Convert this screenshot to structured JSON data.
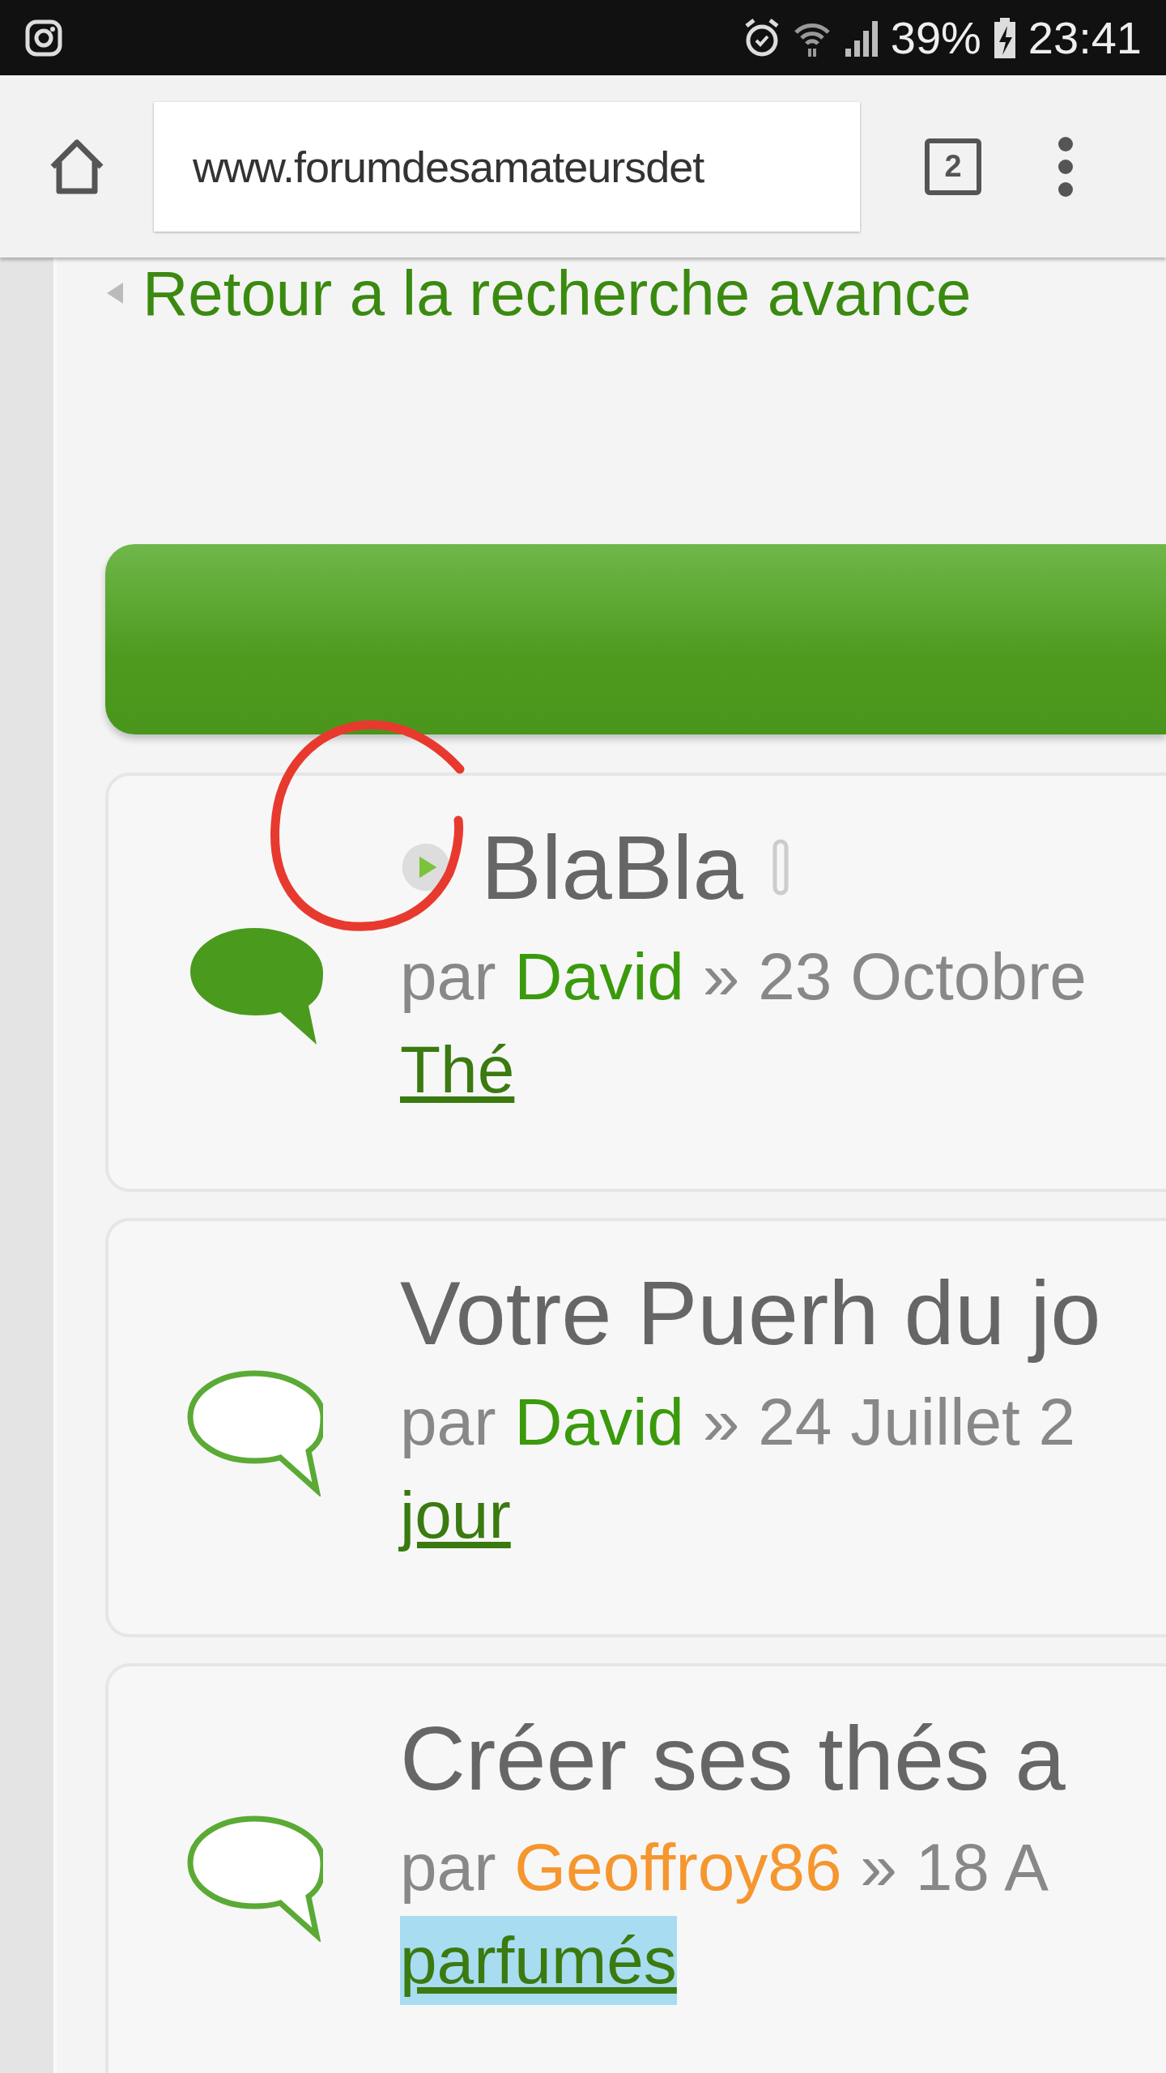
{
  "status_bar": {
    "battery": "39%",
    "time": "23:41"
  },
  "browser": {
    "url": "www.forumdesamateursdet",
    "tab_count": "2"
  },
  "back_link": "Retour a la recherche avance",
  "topics": [
    {
      "title": "BlaBla",
      "unread": true,
      "attachment": true,
      "par": "par",
      "author": "David",
      "color": "#3a9a0c",
      "date": "» 23 Octobre",
      "link": "Thé",
      "highlighted": false
    },
    {
      "title": "Votre Puerh du jo",
      "unread": false,
      "attachment": false,
      "par": "par",
      "author": "David",
      "color": "#3a9a0c",
      "date": "» 24 Juillet 2",
      "link": "jour",
      "highlighted": false
    },
    {
      "title": "Créer ses thés a",
      "unread": false,
      "attachment": false,
      "par": "par",
      "author": "Geoffroy86",
      "color": "#f5962e",
      "date": "» 18 A",
      "link": "parfumés",
      "highlighted": true
    }
  ]
}
